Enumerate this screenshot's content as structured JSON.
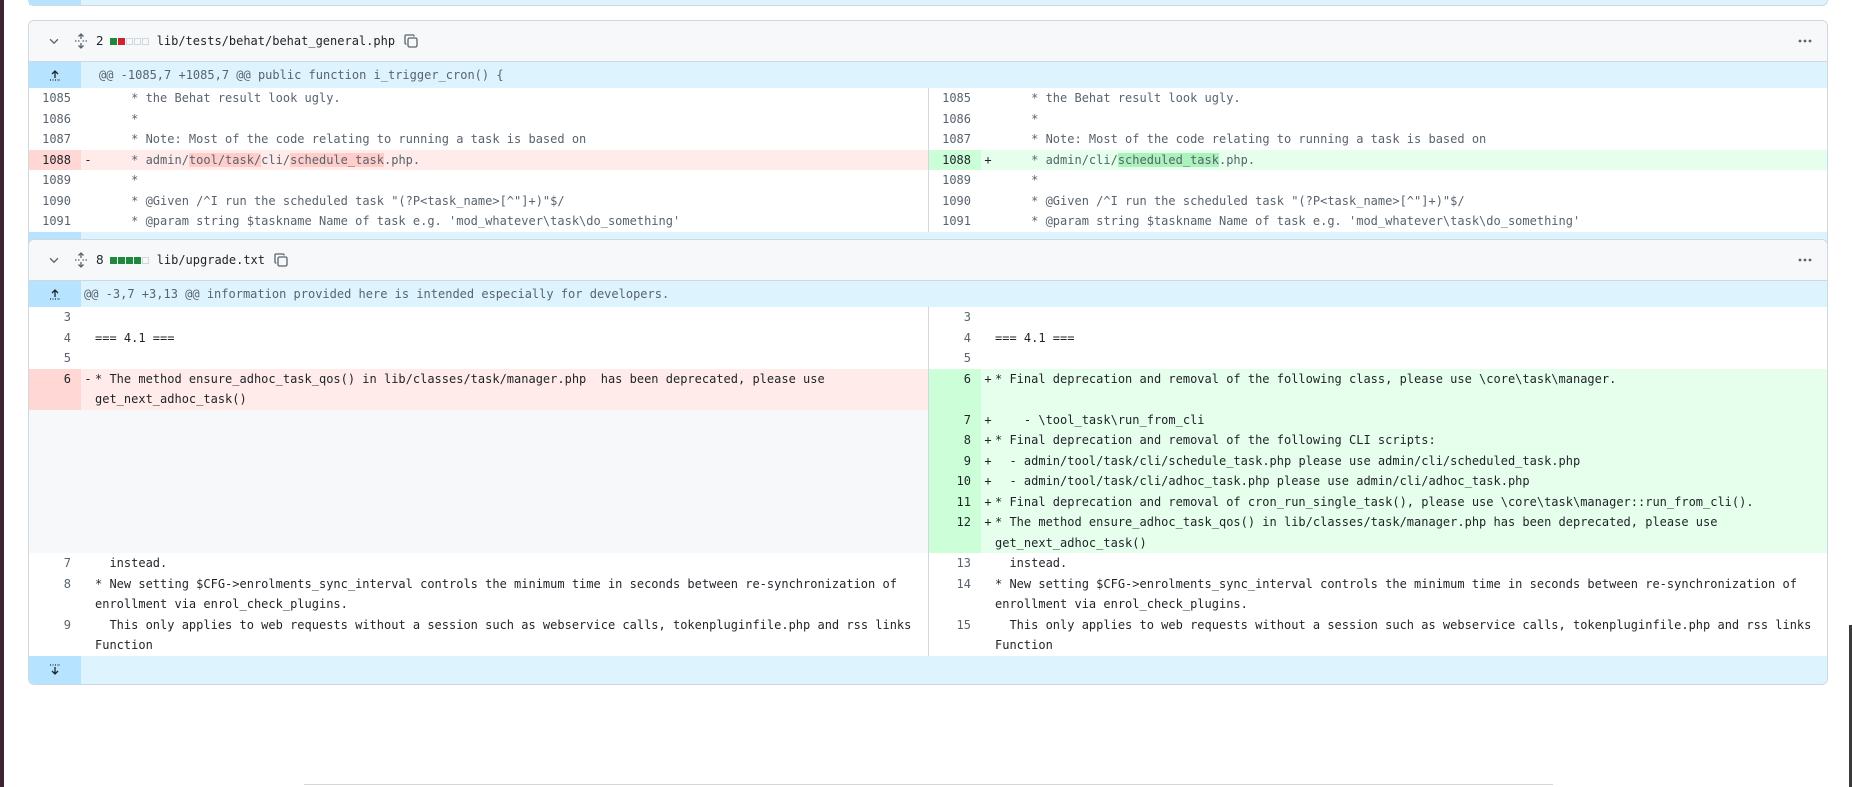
{
  "files": [
    {
      "count": "2",
      "stat": [
        "add",
        "del",
        "neutral",
        "neutral",
        "neutral"
      ],
      "path": "lib/tests/behat/behat_general.php",
      "hunk": "@@ -1085,7 +1085,7 @@ public function i_trigger_cron() {",
      "rows": [
        {
          "l_num": "1085",
          "l_mk": "",
          "l_code": "     * the Behat result look ugly.",
          "l_type": "ctx",
          "r_num": "1085",
          "r_mk": "",
          "r_code": "     * the Behat result look ugly.",
          "r_type": "ctx"
        },
        {
          "l_num": "1086",
          "l_mk": "",
          "l_code": "     *",
          "l_type": "ctx",
          "r_num": "1086",
          "r_mk": "",
          "r_code": "     *",
          "r_type": "ctx"
        },
        {
          "l_num": "1087",
          "l_mk": "",
          "l_code": "     * Note: Most of the code relating to running a task is based on",
          "l_type": "ctx",
          "r_num": "1087",
          "r_mk": "",
          "r_code": "     * Note: Most of the code relating to running a task is based on",
          "r_type": "ctx"
        },
        {
          "l_num": "1088",
          "l_mk": "-",
          "l_parts": [
            {
              "t": "     * admin/"
            },
            {
              "t": "tool/task/",
              "hl": true
            },
            {
              "t": "cli/"
            },
            {
              "t": "schedule_task",
              "hl": true
            },
            {
              "t": ".php."
            }
          ],
          "l_type": "del",
          "r_num": "1088",
          "r_mk": "+",
          "r_parts": [
            {
              "t": "     * admin/cli/"
            },
            {
              "t": "scheduled_task",
              "hl": true
            },
            {
              "t": ".php."
            }
          ],
          "r_type": "add"
        },
        {
          "l_num": "1089",
          "l_mk": "",
          "l_code": "     *",
          "l_type": "ctx",
          "r_num": "1089",
          "r_mk": "",
          "r_code": "     *",
          "r_type": "ctx"
        },
        {
          "l_num": "1090",
          "l_mk": "",
          "l_code": "     * @Given /^I run the scheduled task \"(?P<task_name>[^\"]+)\"$/",
          "l_type": "ctx",
          "r_num": "1090",
          "r_mk": "",
          "r_code": "     * @Given /^I run the scheduled task \"(?P<task_name>[^\"]+)\"$/",
          "r_type": "ctx"
        },
        {
          "l_num": "1091",
          "l_mk": "",
          "l_code": "     * @param string $taskname Name of task e.g. 'mod_whatever\\task\\do_something'",
          "l_type": "ctx",
          "r_num": "1091",
          "r_mk": "",
          "r_code": "     * @param string $taskname Name of task e.g. 'mod_whatever\\task\\do_something'",
          "r_type": "ctx"
        }
      ]
    },
    {
      "count": "8",
      "stat": [
        "add",
        "add",
        "add",
        "add",
        "neutral"
      ],
      "path": "lib/upgrade.txt",
      "hunk": "@@ -3,7 +3,13 @@ information provided here is intended especially for developers.",
      "rows": [
        {
          "l_num": "3",
          "l_mk": "",
          "l_code": "",
          "l_type": "ctx",
          "r_num": "3",
          "r_mk": "",
          "r_code": "",
          "r_type": "ctx"
        },
        {
          "l_num": "4",
          "l_mk": "",
          "l_code": "=== 4.1 ===",
          "l_type": "ctx",
          "r_num": "4",
          "r_mk": "",
          "r_code": "=== 4.1 ===",
          "r_type": "ctx"
        },
        {
          "l_num": "5",
          "l_mk": "",
          "l_code": "",
          "l_type": "ctx",
          "r_num": "5",
          "r_mk": "",
          "r_code": "",
          "r_type": "ctx"
        },
        {
          "l_num": "6",
          "l_mk": "-",
          "l_code": "* The method ensure_adhoc_task_qos() in lib/classes/task/manager.php  has been deprecated, please use\nget_next_adhoc_task()",
          "l_type": "del",
          "r_num": "6",
          "r_mk": "+",
          "r_code": "* Final deprecation and removal of the following class, please use \\core\\task\\manager.\n",
          "r_type": "add"
        },
        {
          "l_num": "",
          "l_mk": "",
          "l_code": "",
          "l_type": "empty",
          "r_num": "7",
          "r_mk": "+",
          "r_code": "    - \\tool_task\\run_from_cli",
          "r_type": "add"
        },
        {
          "l_num": "",
          "l_mk": "",
          "l_code": "",
          "l_type": "empty",
          "r_num": "8",
          "r_mk": "+",
          "r_code": "* Final deprecation and removal of the following CLI scripts:",
          "r_type": "add"
        },
        {
          "l_num": "",
          "l_mk": "",
          "l_code": "",
          "l_type": "empty",
          "r_num": "9",
          "r_mk": "+",
          "r_code": "  - admin/tool/task/cli/schedule_task.php please use admin/cli/scheduled_task.php",
          "r_type": "add"
        },
        {
          "l_num": "",
          "l_mk": "",
          "l_code": "",
          "l_type": "empty",
          "r_num": "10",
          "r_mk": "+",
          "r_code": "  - admin/tool/task/cli/adhoc_task.php please use admin/cli/adhoc_task.php",
          "r_type": "add"
        },
        {
          "l_num": "",
          "l_mk": "",
          "l_code": "",
          "l_type": "empty",
          "r_num": "11",
          "r_mk": "+",
          "r_code": "* Final deprecation and removal of cron_run_single_task(), please use \\core\\task\\manager::run_from_cli().",
          "r_type": "add"
        },
        {
          "l_num": "",
          "l_mk": "",
          "l_code": "",
          "l_type": "empty",
          "r_num": "12",
          "r_mk": "+",
          "r_code": "* The method ensure_adhoc_task_qos() in lib/classes/task/manager.php has been deprecated, please use\nget_next_adhoc_task()",
          "r_type": "add"
        },
        {
          "l_num": "7",
          "l_mk": "",
          "l_code": "  instead.",
          "l_type": "ctx",
          "r_num": "13",
          "r_mk": "",
          "r_code": "  instead.",
          "r_type": "ctx"
        },
        {
          "l_num": "8",
          "l_mk": "",
          "l_code": "* New setting $CFG->enrolments_sync_interval controls the minimum time in seconds between re-synchronization of\nenrollment via enrol_check_plugins.",
          "l_type": "ctx",
          "r_num": "14",
          "r_mk": "",
          "r_code": "* New setting $CFG->enrolments_sync_interval controls the minimum time in seconds between re-synchronization of\nenrollment via enrol_check_plugins.",
          "r_type": "ctx"
        },
        {
          "l_num": "9",
          "l_mk": "",
          "l_code": "  This only applies to web requests without a session such as webservice calls, tokenpluginfile.php and rss links\nFunction",
          "l_type": "ctx",
          "r_num": "15",
          "r_mk": "",
          "r_code": "  This only applies to web requests without a session such as webservice calls, tokenpluginfile.php and rss links\nFunction",
          "r_type": "ctx"
        }
      ]
    }
  ],
  "icons": {
    "collapse": "chevron-down-icon",
    "expand_file": "unfold-icon",
    "copy": "copy-icon",
    "more": "kebab-horizontal-icon",
    "expand_up": "fold-up-icon",
    "expand_down": "fold-down-icon"
  },
  "colors": {
    "del_bg": "#ffebe9",
    "del_num_bg": "#ffd7d5",
    "add_bg": "#e6ffec",
    "add_num_bg": "#ccffd8",
    "hunk_bg": "#ddf4ff",
    "hunk_gutter": "#b6e3ff"
  }
}
